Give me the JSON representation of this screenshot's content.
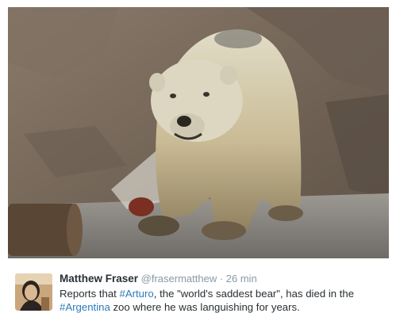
{
  "photo": {
    "alt_subject": "polar-bear"
  },
  "tweet": {
    "author_name": "Matthew Fraser",
    "handle": "@frasermatthew",
    "separator": " · ",
    "time": "26 min",
    "text_part1": "Reports that ",
    "hashtag1": "#Arturo",
    "text_part2": ", the \"world's saddest bear\", has died in the ",
    "hashtag2": "#Argentina",
    "text_part3": " zoo where he was languishing for years."
  },
  "colors": {
    "link": "#2b7bb9",
    "name": "#292f33",
    "meta": "#8899a6"
  }
}
